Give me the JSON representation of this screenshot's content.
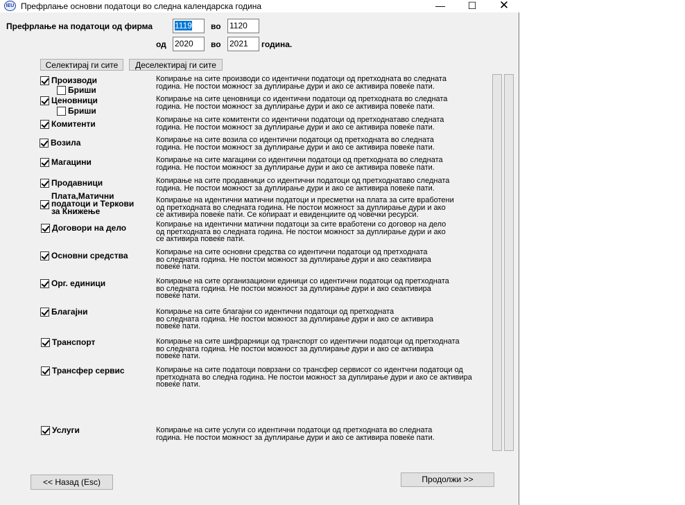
{
  "window": {
    "title": "Префрлање основни податоци во следна календарска година",
    "icon_text": "IEU",
    "minimize": "—",
    "maximize": "☐",
    "close": "✕"
  },
  "header": {
    "transfer_label": "Префрлање на податоци од фирма",
    "from_firm": "1119",
    "to_label_1": "во",
    "to_firm": "1120",
    "from_year_label": "од",
    "from_year": "2020",
    "to_label_2": "во",
    "to_year": "2021",
    "year_suffix": "година."
  },
  "toolbar": {
    "select_all": "Селектирај ги сите",
    "deselect_all": "Деселектирај ги сите"
  },
  "items": [
    {
      "label": "Производи",
      "checked": true,
      "desc": "Копирање на сите производи со идентични податоци од претходната во следната\nгодина. Не постои можност за дуплирање дури и ако се активира повеќе пати."
    },
    {
      "label": "Бриши",
      "checked": false
    },
    {
      "label": "Ценовници",
      "checked": true,
      "desc": "Копирање на сите ценовници со идентични податоци од претходната во следната\nгодина. Не постои можност за дуплирање дури и ако се активира повеќе пати."
    },
    {
      "label": "Бриши",
      "checked": false
    },
    {
      "label": "Комитенти",
      "checked": true,
      "desc": "Копирање на сите комитенти со идентични податоци од претходнатаво следната\nгодина. Не постои можност за дуплирање дури и ако се активира повеќе пати."
    },
    {
      "label": "Возила",
      "checked": true,
      "desc": "Копирање на сите возила со идентични податоци од претходната во следната\nгодина. Не постои можност за дуплирање дури и ако се активира повеќе пати."
    },
    {
      "label": "Магацини",
      "checked": true,
      "desc": "Копирање на сите магацини со идентични податоци од претходната во следната\nгодина. Не постои можност за дуплирање дури и ако се активира повеќе пати."
    },
    {
      "label": "Продавници",
      "checked": true,
      "desc": "Копирање на сите продавници со идентични податоци од претходнатаво следната\nгодина. Не постои можност за дуплирање дури и ако се активира повеќе пати."
    },
    {
      "label": "Плата,Матични\nподатоци и Теркови\nза Книжење",
      "checked": true,
      "desc": "Копирање на идентични матични податоци и пресметки на плата за сите вработени\nод претходната во следната година. Не постои можност за дуплирање дури и ако\nсе активира повеќе пати. Се копираат и евиденциите од човечки ресурси."
    },
    {
      "label": "Договори на дело",
      "checked": true,
      "desc": "Копирање на идентични матични податоци за сите вработени со договор на дело\nод претходната во следната година. Не постои можност за дуплирање дури и ако\nсе активира повеќе пати."
    },
    {
      "label": "Основни средства",
      "checked": true,
      "desc": "Копирање на сите основни средства со идентични податоци од претходната\nво следната година. Не постои можност за дуплирање дури и ако сеактивира\nповеќе пати."
    },
    {
      "label": "Орг. единици",
      "checked": true,
      "desc": "Копирање на сите организациони единици со идентични податоци од претходната\nво следната година. Не постои можност за дуплирање дури и ако сеактивира\nповеќе пати."
    },
    {
      "label": "Благајни",
      "checked": true,
      "desc": "Копирање на сите благајни со идентични податоци од претходната\nво следната година. Не постои можност за дуплирање дури и ако се активира\nповеќе пати."
    },
    {
      "label": "Транспорт",
      "checked": true,
      "desc": "Копирање на сите шифрарници од транспорт со идентични податоци од претходната\nво следната година. Не постои можност за дуплирање дури и ако се активира\nповеќе пати."
    },
    {
      "label": "Трансфер сервис",
      "checked": true,
      "desc": "Копирање на сите податоци поврзани со трансфер сервисот со идентчни податоци од\nпретходната во следна година. Не постои можност за дуплирање дури и ако се активира\nповеќе пати."
    },
    {
      "label": "Услуги",
      "checked": true,
      "desc": "Копирање на сите услуги со идентични податоци од претходната во следната\nгодина. Не постои можност за дуплирање дури и ако се активира повеќе пати."
    }
  ],
  "footer": {
    "back": "<< Назад (Esc)",
    "continue": "Продолжи >>"
  }
}
